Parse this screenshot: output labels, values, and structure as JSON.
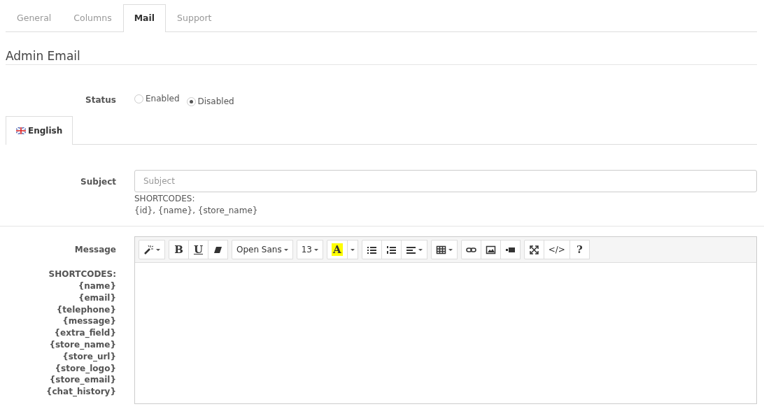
{
  "tabs": [
    {
      "label": "General",
      "selected": false
    },
    {
      "label": "Columns",
      "selected": false
    },
    {
      "label": "Mail",
      "selected": true
    },
    {
      "label": "Support",
      "selected": false
    }
  ],
  "section_title": "Admin Email",
  "status": {
    "label": "Status",
    "options": [
      {
        "label": "Enabled",
        "selected": false
      },
      {
        "label": "Disabled",
        "selected": true
      }
    ]
  },
  "language_tabs": [
    {
      "label": "English",
      "selected": true
    }
  ],
  "subject": {
    "label": "Subject",
    "placeholder": "Subject",
    "help_title": "SHORTCODES:",
    "help_text": "{id}, {name}, {store_name}"
  },
  "message": {
    "label": "Message",
    "shortcodes_title": "SHORTCODES:",
    "shortcodes": [
      "{name}",
      "{email}",
      "{telephone}",
      "{message}",
      "{extra_field}",
      "{store_name}",
      "{store_url}",
      "{store_logo}",
      "{store_email}",
      "{chat_history}"
    ],
    "toolbar": [
      [
        {
          "kind": "icon",
          "caret": true
        }
      ],
      [
        {
          "kind": "bold",
          "label": "B"
        },
        {
          "kind": "underline",
          "label": "U"
        },
        {
          "kind": "icon"
        }
      ],
      [
        {
          "kind": "text",
          "label": "Open Sans",
          "caret": true
        }
      ],
      [
        {
          "kind": "text",
          "label": "13",
          "caret": true
        }
      ],
      [
        {
          "kind": "color",
          "label": "A"
        },
        {
          "kind": "caret"
        }
      ],
      [
        {
          "kind": "icon"
        },
        {
          "kind": "icon"
        },
        {
          "kind": "icon",
          "caret": true
        }
      ],
      [
        {
          "kind": "icon",
          "caret": true
        }
      ],
      [
        {
          "kind": "icon"
        },
        {
          "kind": "icon"
        },
        {
          "kind": "icon"
        }
      ],
      [
        {
          "kind": "icon"
        },
        {
          "kind": "text",
          "label": "</>"
        },
        {
          "kind": "bold",
          "label": "?"
        }
      ]
    ]
  }
}
